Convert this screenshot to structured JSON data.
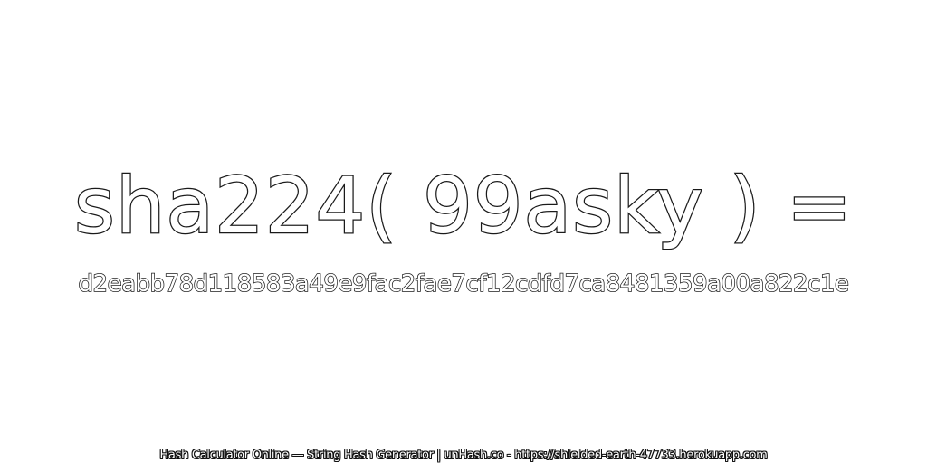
{
  "headline": "sha224( 99asky ) =",
  "hash_value": "d2eabb78d118583a49e9fac2fae7cf12cdfd7ca8481359a00a822c1e",
  "footer": "Hash Calculator Online — String Hash Generator | unHash.co - https://shielded-earth-47733.herokuapp.com"
}
